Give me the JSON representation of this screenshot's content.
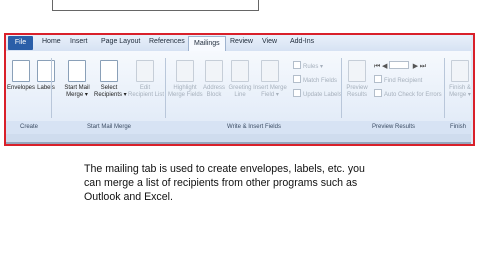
{
  "ribbon": {
    "tabs": [
      "File",
      "Home",
      "Insert",
      "Page Layout",
      "References",
      "Mailings",
      "Review",
      "View",
      "Add-Ins"
    ],
    "active_tab": "Mailings",
    "create": {
      "envelopes": "Envelopes",
      "labels": "Labels"
    },
    "start_mail_merge": {
      "start": [
        "Start Mail",
        "Merge ▾"
      ],
      "select": [
        "Select",
        "Recipients ▾"
      ],
      "edit": [
        "Edit",
        "Recipient List"
      ]
    },
    "write_insert": {
      "highlight": [
        "Highlight",
        "Merge Fields"
      ],
      "address": [
        "Address",
        "Block"
      ],
      "greeting": [
        "Greeting",
        "Line"
      ],
      "insert_merge": [
        "Insert Merge",
        "Field ▾"
      ],
      "rules": "Rules ▾",
      "match": "Match Fields",
      "update": "Update Labels"
    },
    "preview": {
      "preview": [
        "Preview",
        "Results"
      ],
      "find": "Find Recipient",
      "auto_check": "Auto Check for Errors"
    },
    "finish": {
      "finish": [
        "Finish &",
        "Merge ▾"
      ]
    },
    "groups": {
      "create": "Create",
      "start_mail_merge": "Start Mail Merge",
      "write_insert": "Write & Insert Fields",
      "preview": "Preview Results",
      "finish": "Finish"
    }
  },
  "caption": "The mailing tab is used to create envelopes, labels, etc. you can merge a list of recipients from other programs such as Outlook and Excel."
}
